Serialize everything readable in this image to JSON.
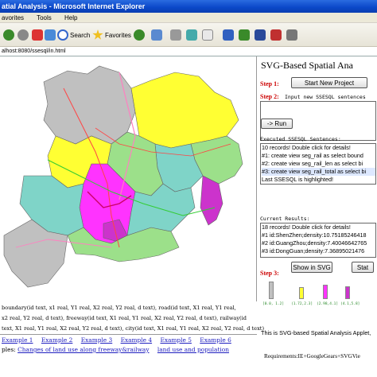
{
  "window": {
    "title": "atial Analysis - Microsoft Internet Explorer"
  },
  "menu": {
    "items": [
      "avorites",
      "Tools",
      "Help"
    ]
  },
  "toolbar": {
    "search_label": "Search",
    "favorites_label": "Favorites"
  },
  "address": {
    "url": "alhost:8080/ssesql/in.html"
  },
  "panel": {
    "title": "SVG-Based Spatial Ana",
    "step1_label": "Step 1:",
    "new_project_button": "Start New Project",
    "step2_label": "Step 2:",
    "step2_text": "Input new SSESQL sentences",
    "run_button": "-> Run",
    "executed_label": "Executed SSESQL Sentences:",
    "executed_lines": [
      "10 records! Double click for details!",
      "#1: create view seg_rail as select bound",
      "#2: create view seg_rail_len as select bi",
      "#3: create view seg_rail_total as select bi",
      "Last SSESQL is highlighted!"
    ],
    "current_label": "Current Results:",
    "result_lines": [
      "18 records! Double click for details!",
      "#1 id:ShenZhen;density:10.75185246418",
      "#2 id:GuangZhou;density:7.40046642765",
      "#3 id:DongGuan;density:7.36895021476"
    ],
    "show_svg_button": "Show in SVG",
    "stat_button": "Stat",
    "step3_label": "Step 3:",
    "legend_ranges": [
      "[0.0, 1.2]",
      "(1.72,2.3]",
      "(2.98,4.1]",
      "(4.1,5.8]"
    ],
    "footer_text": "This is SVG-based Spatial Analysis Applet,",
    "requirements": "Requirements:IE+GoogleGears+SVGVie"
  },
  "bottom": {
    "schema_line1": "boundary(id text, x1 real, Y1 real, X2 real, Y2 real, d text),   road(id text, X1 real, Y1 real,",
    "schema_line2": "x2 real, Y2 real, d text),  freeway(id text, X1 real, Y1 real, X2 real, Y2 real, d text),  railway(id",
    "schema_line3": "text, X1 real, Y1 real, X2 real, Y2 real, d text), city(id text, X1 real, Y1 real, X2 real, Y2 real, d text)",
    "examples": [
      "Example 1",
      "Example 2",
      "Example 3",
      "Example 4",
      "Example 5",
      "Example 6"
    ],
    "examples_prefix": "ples:",
    "example_topics": [
      "Changes of land use along freeway&railway",
      "land use and population"
    ]
  },
  "colors": {
    "gray": "#c0c0c0",
    "yellow": "#ffff33",
    "teal": "#7fd4c8",
    "green": "#9ce08a",
    "magenta": "#ff33ff",
    "purple": "#cc33cc",
    "road_red": "#ff4444",
    "rail_pink": "#ff80c0",
    "freeway_green": "#33cc33"
  }
}
